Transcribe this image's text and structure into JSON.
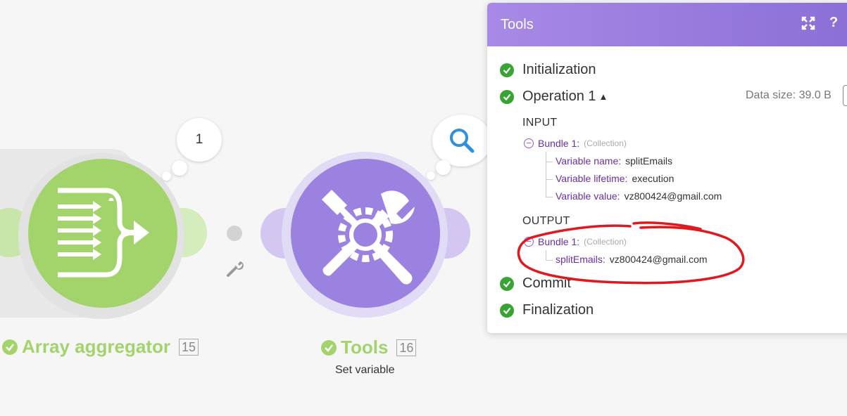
{
  "canvas": {
    "aggregator": {
      "name": "Array aggregator",
      "id": "15",
      "bubble_count": "1",
      "color": "#a3d46c"
    },
    "tools": {
      "name": "Tools",
      "id": "16",
      "subtitle": "Set variable",
      "color": "#9b82e0"
    },
    "search_icon": "magnifier-icon",
    "wrench_icon": "wrench-icon"
  },
  "panel": {
    "title": "Tools",
    "expand_icon": "expand-icon",
    "help_label": "?",
    "stages": {
      "initialization": "Initialization",
      "operation": "Operation 1",
      "commit": "Commit",
      "finalization": "Finalization"
    },
    "data_size": "Data size: 39.0 B",
    "input": {
      "title": "INPUT",
      "bundle_label": "Bundle 1:",
      "bundle_type": "(Collection)",
      "rows": [
        {
          "key": "Variable name:",
          "value": "splitEmails"
        },
        {
          "key": "Variable lifetime:",
          "value": "execution"
        },
        {
          "key": "Variable value:",
          "value": "vz800424@gmail.com"
        }
      ]
    },
    "output": {
      "title": "OUTPUT",
      "bundle_label": "Bundle 1:",
      "bundle_type": "(Collection)",
      "rows": [
        {
          "key": "splitEmails:",
          "value": "vz800424@gmail.com"
        }
      ]
    },
    "annotation_color": "#e0191e",
    "success_color": "#3aa335"
  }
}
